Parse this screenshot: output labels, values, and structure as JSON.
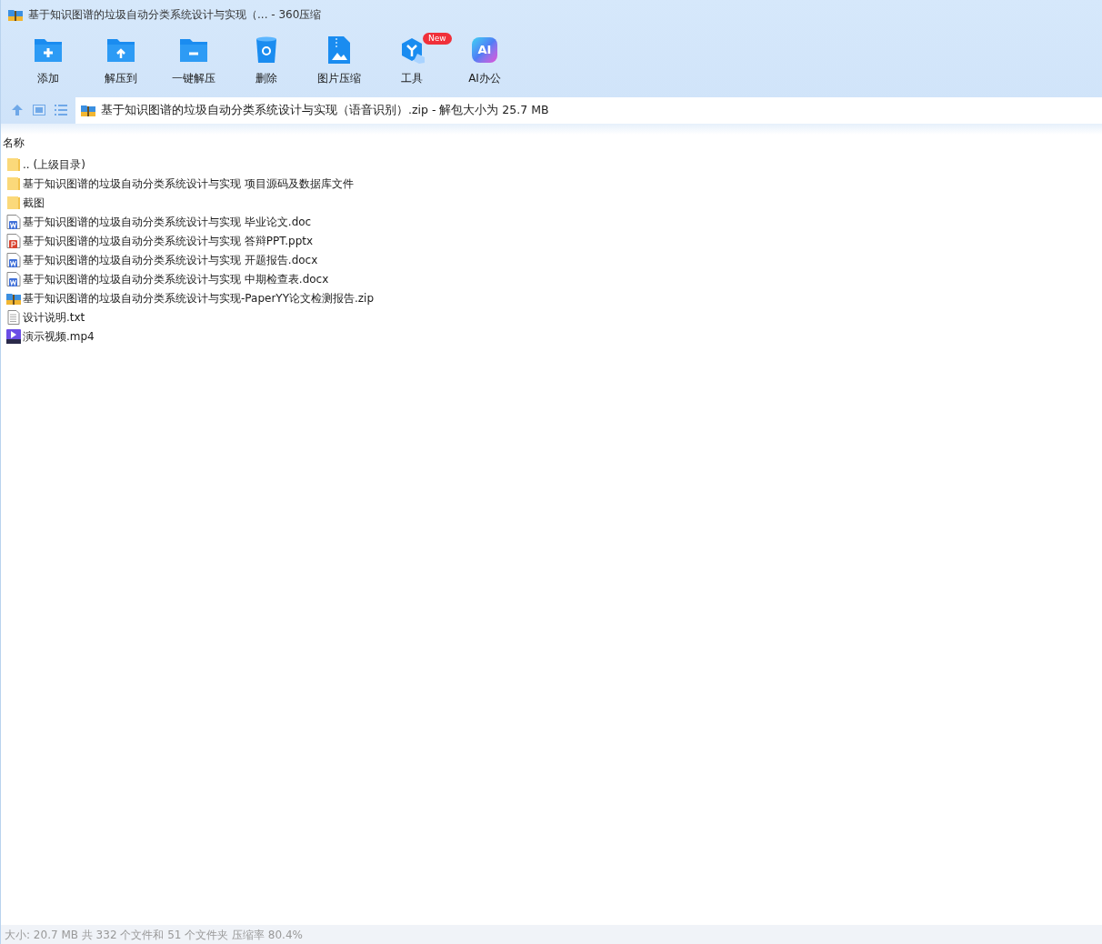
{
  "window": {
    "title": "基于知识图谱的垃圾自动分类系统设计与实现（... - 360压缩"
  },
  "toolbar": [
    {
      "kind": "add",
      "label": "添加"
    },
    {
      "kind": "extract",
      "label": "解压到"
    },
    {
      "kind": "onekey",
      "label": "一键解压"
    },
    {
      "kind": "delete",
      "label": "删除"
    },
    {
      "kind": "image",
      "label": "图片压缩"
    },
    {
      "kind": "tools",
      "label": "工具",
      "badge": "New"
    },
    {
      "kind": "ai",
      "label": "AI办公",
      "icon_text": "AI"
    }
  ],
  "address": {
    "path": "基于知识图谱的垃圾自动分类系统设计与实现（语音识别）.zip - 解包大小为 25.7 MB"
  },
  "columns": [
    "名称"
  ],
  "files": [
    {
      "kind": "folder",
      "name": ".. (上级目录)"
    },
    {
      "kind": "folder",
      "name": "基于知识图谱的垃圾自动分类系统设计与实现 项目源码及数据库文件"
    },
    {
      "kind": "folder",
      "name": "截图"
    },
    {
      "kind": "word",
      "name": "基于知识图谱的垃圾自动分类系统设计与实现 毕业论文.doc"
    },
    {
      "kind": "ppt",
      "name": "基于知识图谱的垃圾自动分类系统设计与实现 答辩PPT.pptx"
    },
    {
      "kind": "word",
      "name": "基于知识图谱的垃圾自动分类系统设计与实现 开题报告.docx"
    },
    {
      "kind": "word",
      "name": "基于知识图谱的垃圾自动分类系统设计与实现 中期检查表.docx"
    },
    {
      "kind": "zip",
      "name": "基于知识图谱的垃圾自动分类系统设计与实现-PaperYY论文检测报告.zip"
    },
    {
      "kind": "txt",
      "name": "设计说明.txt"
    },
    {
      "kind": "video",
      "name": "演示视频.mp4"
    }
  ],
  "status_bar": "大小: 20.7 MB 共 332 个文件和 51 个文件夹 压缩率 80.4%"
}
